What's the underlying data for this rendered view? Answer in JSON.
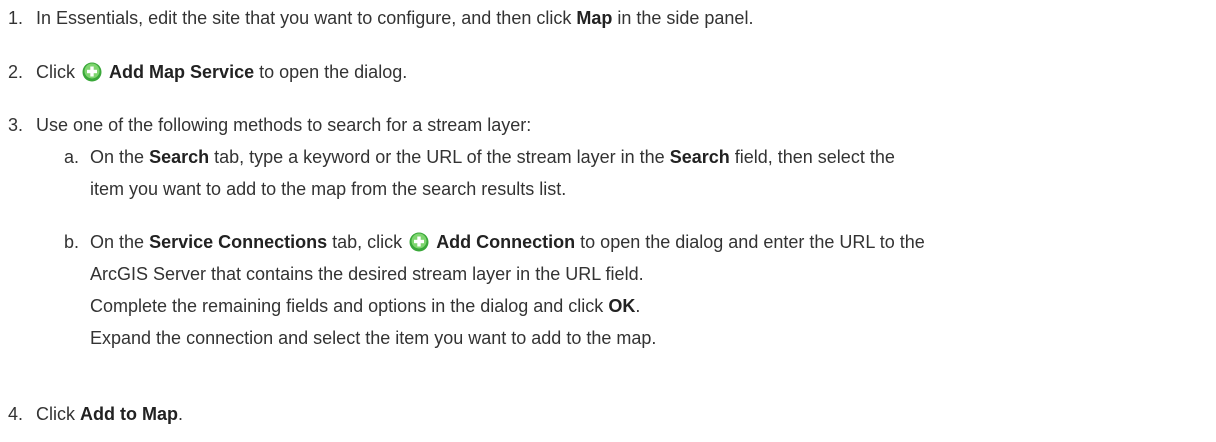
{
  "steps": [
    {
      "number": "1.",
      "lines": [
        {
          "pre": "In Essentials, edit the site that you want to configure, and then click ",
          "bold": "Map",
          "post": " in the side panel."
        }
      ]
    },
    {
      "number": "2.",
      "lines": [
        {
          "pre": "Click ",
          "icon": "add-plus-icon",
          "bold": "Add Map Service",
          "post": " to open the dialog."
        }
      ]
    },
    {
      "number": "3.",
      "lines": [
        {
          "pre": "Use one of the following methods to search for a stream layer:"
        }
      ]
    },
    {
      "number": "4.",
      "lines": [
        {
          "pre": "Click ",
          "bold": "Add to Map",
          "post": "."
        }
      ]
    }
  ],
  "substeps": [
    {
      "letter": "a.",
      "lines": [
        {
          "pre": "On the ",
          "bold1": "Search",
          "mid": " tab, type a keyword or the URL of the stream layer in the ",
          "bold2": "Search",
          "post": " field, then select the"
        },
        {
          "text": "item you want to add to the map from the search results list."
        }
      ]
    },
    {
      "letter": "b.",
      "lines": [
        {
          "pre": "On the ",
          "bold1": "Service Connections",
          "mid": " tab, click ",
          "icon": "add-plus-icon",
          "bold2": "Add Connection",
          "post": " to open the dialog and enter the URL to the"
        },
        {
          "text": "ArcGIS Server that contains the desired stream layer in the URL field."
        },
        {
          "pre": "Complete the remaining fields and options in the dialog and click ",
          "bold": "OK",
          "post": "."
        },
        {
          "text": "Expand the connection and select the item you want to add to the map."
        }
      ]
    }
  ],
  "colors": {
    "icon_outer": "#3aa83a",
    "icon_inner": "#7ed56f",
    "icon_plus": "#ffffff",
    "text": "#333333"
  }
}
